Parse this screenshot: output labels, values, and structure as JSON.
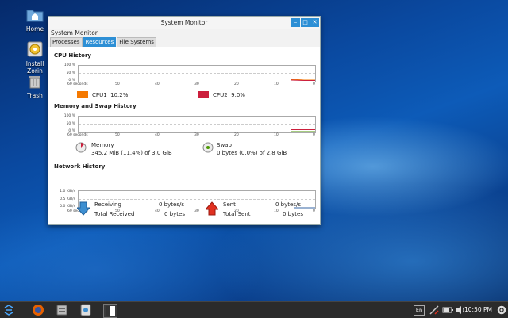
{
  "desktop": {
    "icons": [
      {
        "label": "Home"
      },
      {
        "label": "Install Zorin"
      },
      {
        "label": "Trash"
      }
    ]
  },
  "window": {
    "title": "System Monitor",
    "app_name": "System Monitor",
    "tabs": [
      {
        "label": "Processes",
        "active": false
      },
      {
        "label": "Resources",
        "active": true
      },
      {
        "label": "File Systems",
        "active": false
      }
    ]
  },
  "cpu": {
    "heading": "CPU History",
    "y_ticks": [
      "100 %",
      "50 %",
      "0 %"
    ],
    "x_ticks": [
      "60 seconds",
      "50",
      "40",
      "30",
      "20",
      "10",
      "0"
    ],
    "series": [
      {
        "name": "CPU1",
        "value": "10.2%",
        "color": "#f57900"
      },
      {
        "name": "CPU2",
        "value": "9.0%",
        "color": "#cc1f3c"
      }
    ]
  },
  "memory": {
    "heading": "Memory and Swap History",
    "y_ticks": [
      "100 %",
      "50 %",
      "0 %"
    ],
    "x_ticks": [
      "60 seconds",
      "50",
      "40",
      "30",
      "20",
      "10",
      "0"
    ],
    "memory_label": "Memory",
    "memory_value": "345.2 MiB (11.4%) of 3.0 GiB",
    "memory_fraction": 0.114,
    "swap_label": "Swap",
    "swap_value": "0 bytes (0.0%) of 2.8 GiB",
    "swap_fraction": 0.0
  },
  "network": {
    "heading": "Network History",
    "y_ticks": [
      "1.0 KiB/s",
      "0.5 KiB/s",
      "0.0 KiB/s"
    ],
    "x_ticks": [
      "60 seconds",
      "50",
      "40",
      "30",
      "20",
      "10",
      "0"
    ],
    "receiving_label": "Receiving",
    "receiving_value": "0 bytes/s",
    "total_received_label": "Total Received",
    "total_received_value": "0 bytes",
    "sent_label": "Sent",
    "sent_value": "0 bytes/s",
    "total_sent_label": "Total Sent",
    "total_sent_value": "0 bytes"
  },
  "taskbar": {
    "keyboard_layout": "En",
    "clock": "10:50 PM"
  }
}
